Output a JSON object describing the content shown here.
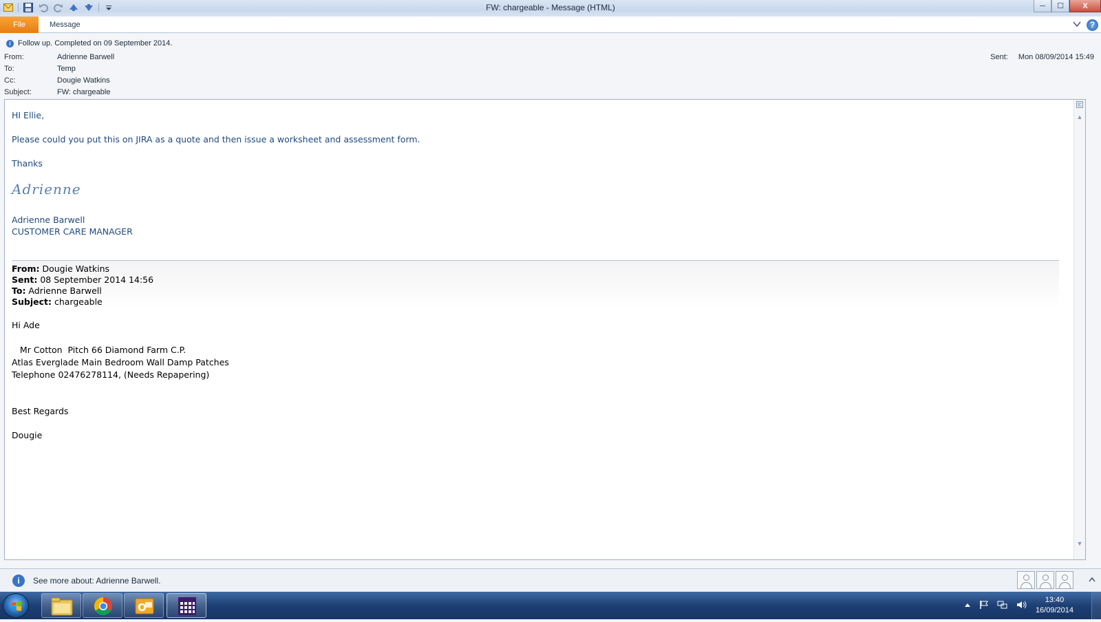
{
  "window": {
    "title": "FW: chargeable  -  Message (HTML)",
    "controls": {
      "minimize": "─",
      "maximize": "☐",
      "close": "X"
    }
  },
  "ribbon": {
    "file_label": "File",
    "message_label": "Message",
    "help_label": "?"
  },
  "header": {
    "follow_up": "Follow up.  Completed on 09 September 2014.",
    "from_label": "From:",
    "from_value": "Adrienne Barwell",
    "to_label": "To:",
    "to_value": "Temp",
    "cc_label": "Cc:",
    "cc_value": "Dougie Watkins",
    "subject_label": "Subject:",
    "subject_value": "FW: chargeable",
    "sent_label": "Sent:",
    "sent_value": "Mon 08/09/2014 15:49"
  },
  "body": {
    "greeting": "HI Ellie,",
    "request": "Please could you put this on JIRA as a quote and then issue a worksheet and assessment form.",
    "thanks": "Thanks",
    "signature_script": "Adrienne",
    "signature_name": "Adrienne Barwell",
    "signature_title": "CUSTOMER CARE MANAGER",
    "fwd": {
      "from_label": "From:",
      "from_value": " Dougie Watkins",
      "sent_label": "Sent:",
      "sent_value": " 08 September 2014 14:56",
      "to_label": "To:",
      "to_value": " Adrienne Barwell",
      "subject_label": "Subject:",
      "subject_value": " chargeable"
    },
    "fwd_greeting": "Hi Ade",
    "line1": "   Mr Cotton  Pitch 66 Diamond Farm C.P.",
    "line2": "Atlas Everglade Main Bedroom Wall Damp Patches",
    "line3": "Telephone 02476278114,  (Needs Repapering)",
    "regards": "Best Regards",
    "sign_off": "Dougie"
  },
  "people_pane": {
    "see_more": "See more about: Adrienne Barwell."
  },
  "taskbar": {
    "time": "13:40",
    "date": "16/09/2014"
  }
}
